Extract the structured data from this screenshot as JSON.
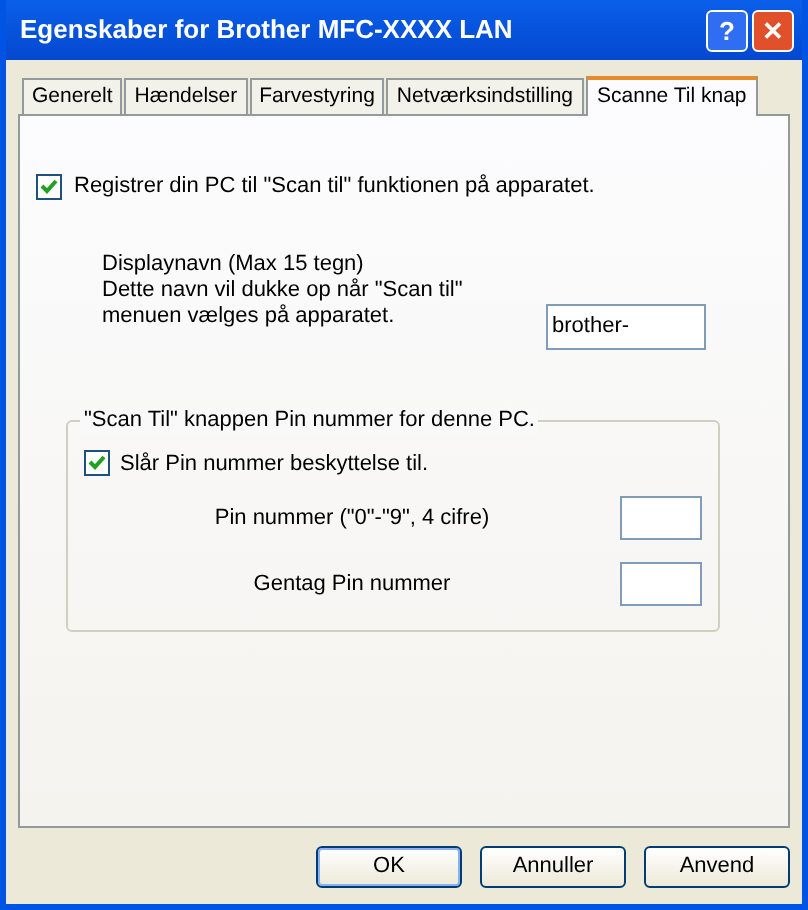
{
  "window": {
    "title": "Egenskaber for Brother MFC-XXXX LAN",
    "title_buttons": [
      "?",
      "✕"
    ]
  },
  "tabs": [
    {
      "label": "Generelt",
      "selected": false
    },
    {
      "label": "Hændelser",
      "selected": false
    },
    {
      "label": "Farvestyring",
      "selected": false
    },
    {
      "label": "Netværksindstilling",
      "selected": false
    },
    {
      "label": "Scanne Til knap",
      "selected": true
    }
  ],
  "register": {
    "label": "Registrer din PC til \"Scan til\" funktionen på apparatet.",
    "checked": true
  },
  "display_name": {
    "lines": [
      "Displaynavn (Max 15 tegn)",
      "Dette navn vil dukke op når \"Scan til\"",
      "menuen vælges på apparatet."
    ],
    "value": "brother-"
  },
  "pin_group": {
    "title": "\"Scan Til\" knappen Pin nummer for denne PC.",
    "protect": {
      "label": "Slår Pin nummer beskyttelse til.",
      "checked": true
    },
    "fields": [
      {
        "label": "Pin nummer (\"0\"-\"9\", 4 cifre)"
      },
      {
        "label": "Gentag Pin nummer"
      }
    ]
  },
  "buttons": [
    {
      "label": "OK",
      "default": true
    },
    {
      "label": "Annuller",
      "default": false
    },
    {
      "label": "Anvend",
      "default": false
    }
  ]
}
